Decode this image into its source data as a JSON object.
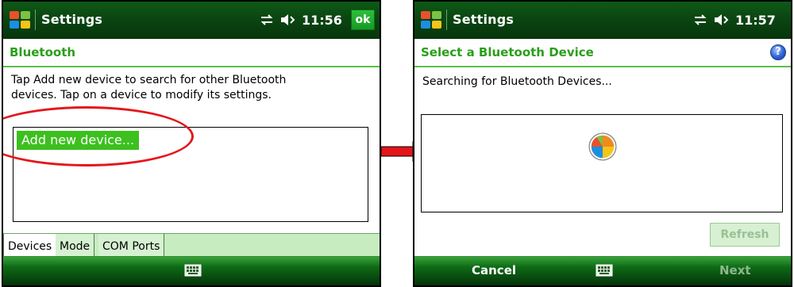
{
  "left_screen": {
    "title": "Settings",
    "time": "11:56",
    "ok_label": "ok",
    "subheading": "Bluetooth",
    "description": "Tap Add new device to search for other Bluetooth devices. Tap on a device to modify its settings.",
    "list_items": [
      "Add new device..."
    ],
    "tabs": [
      "Devices",
      "Mode",
      "COM Ports"
    ],
    "active_tab": "Devices"
  },
  "right_screen": {
    "title": "Settings",
    "time": "11:57",
    "subheading": "Select a Bluetooth Device",
    "help_label": "?",
    "status_text": "Searching for Bluetooth Devices...",
    "refresh_label": "Refresh",
    "softkey_left": "Cancel",
    "softkey_right": "Next"
  },
  "colors": {
    "accent_green": "#2a9e1a",
    "selection_green": "#3cc01e",
    "annotation_red": "#e4161b"
  },
  "icons": [
    "windows-start-icon",
    "connectivity-icon",
    "volume-icon",
    "keyboard-icon",
    "busy-spinner-icon",
    "help-icon",
    "right-arrow-icon"
  ]
}
